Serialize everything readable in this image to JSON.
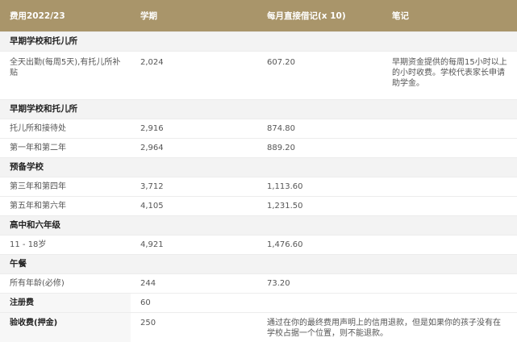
{
  "table": {
    "headers": [
      "费用2022/23",
      "学期",
      "每月直接借记(x 10)",
      "笔记"
    ],
    "rows": [
      {
        "kind": "section",
        "label": "早期学校和托儿所"
      },
      {
        "kind": "data",
        "label": "全天出勤(每周5天),有托儿所补贴",
        "term": "2,024",
        "monthly": "607.20",
        "note": "早期资金提供的每周15小时以上的小时收费。学校代表家长申请助学金。"
      },
      {
        "kind": "section",
        "label": "早期学校和托儿所"
      },
      {
        "kind": "data",
        "label": "托儿所和接待处",
        "term": "2,916",
        "monthly": "874.80",
        "note": ""
      },
      {
        "kind": "data",
        "label": "第一年和第二年",
        "term": "2,964",
        "monthly": "889.20",
        "note": ""
      },
      {
        "kind": "section",
        "label": "预备学校"
      },
      {
        "kind": "data",
        "label": "第三年和第四年",
        "term": "3,712",
        "monthly": "1,113.60",
        "note": ""
      },
      {
        "kind": "data",
        "label": "第五年和第六年",
        "term": "4,105",
        "monthly": "1,231.50",
        "note": ""
      },
      {
        "kind": "section",
        "label": "高中和六年级"
      },
      {
        "kind": "data",
        "label": "11 - 18岁",
        "term": "4,921",
        "monthly": "1,476.60",
        "note": ""
      },
      {
        "kind": "section",
        "label": "午餐"
      },
      {
        "kind": "data",
        "label": "所有年龄(必修)",
        "term": "244",
        "monthly": "73.20",
        "note": ""
      },
      {
        "kind": "bold",
        "label": "注册费",
        "term": "60",
        "monthly": "",
        "note": ""
      },
      {
        "kind": "bold",
        "label": "验收费(押金)",
        "term": "250",
        "monthly": "",
        "note": "通过在你的最终费用声明上的信用退款，但是如果你的孩子没有在学校占据一个位置，则不能退款。"
      }
    ]
  }
}
